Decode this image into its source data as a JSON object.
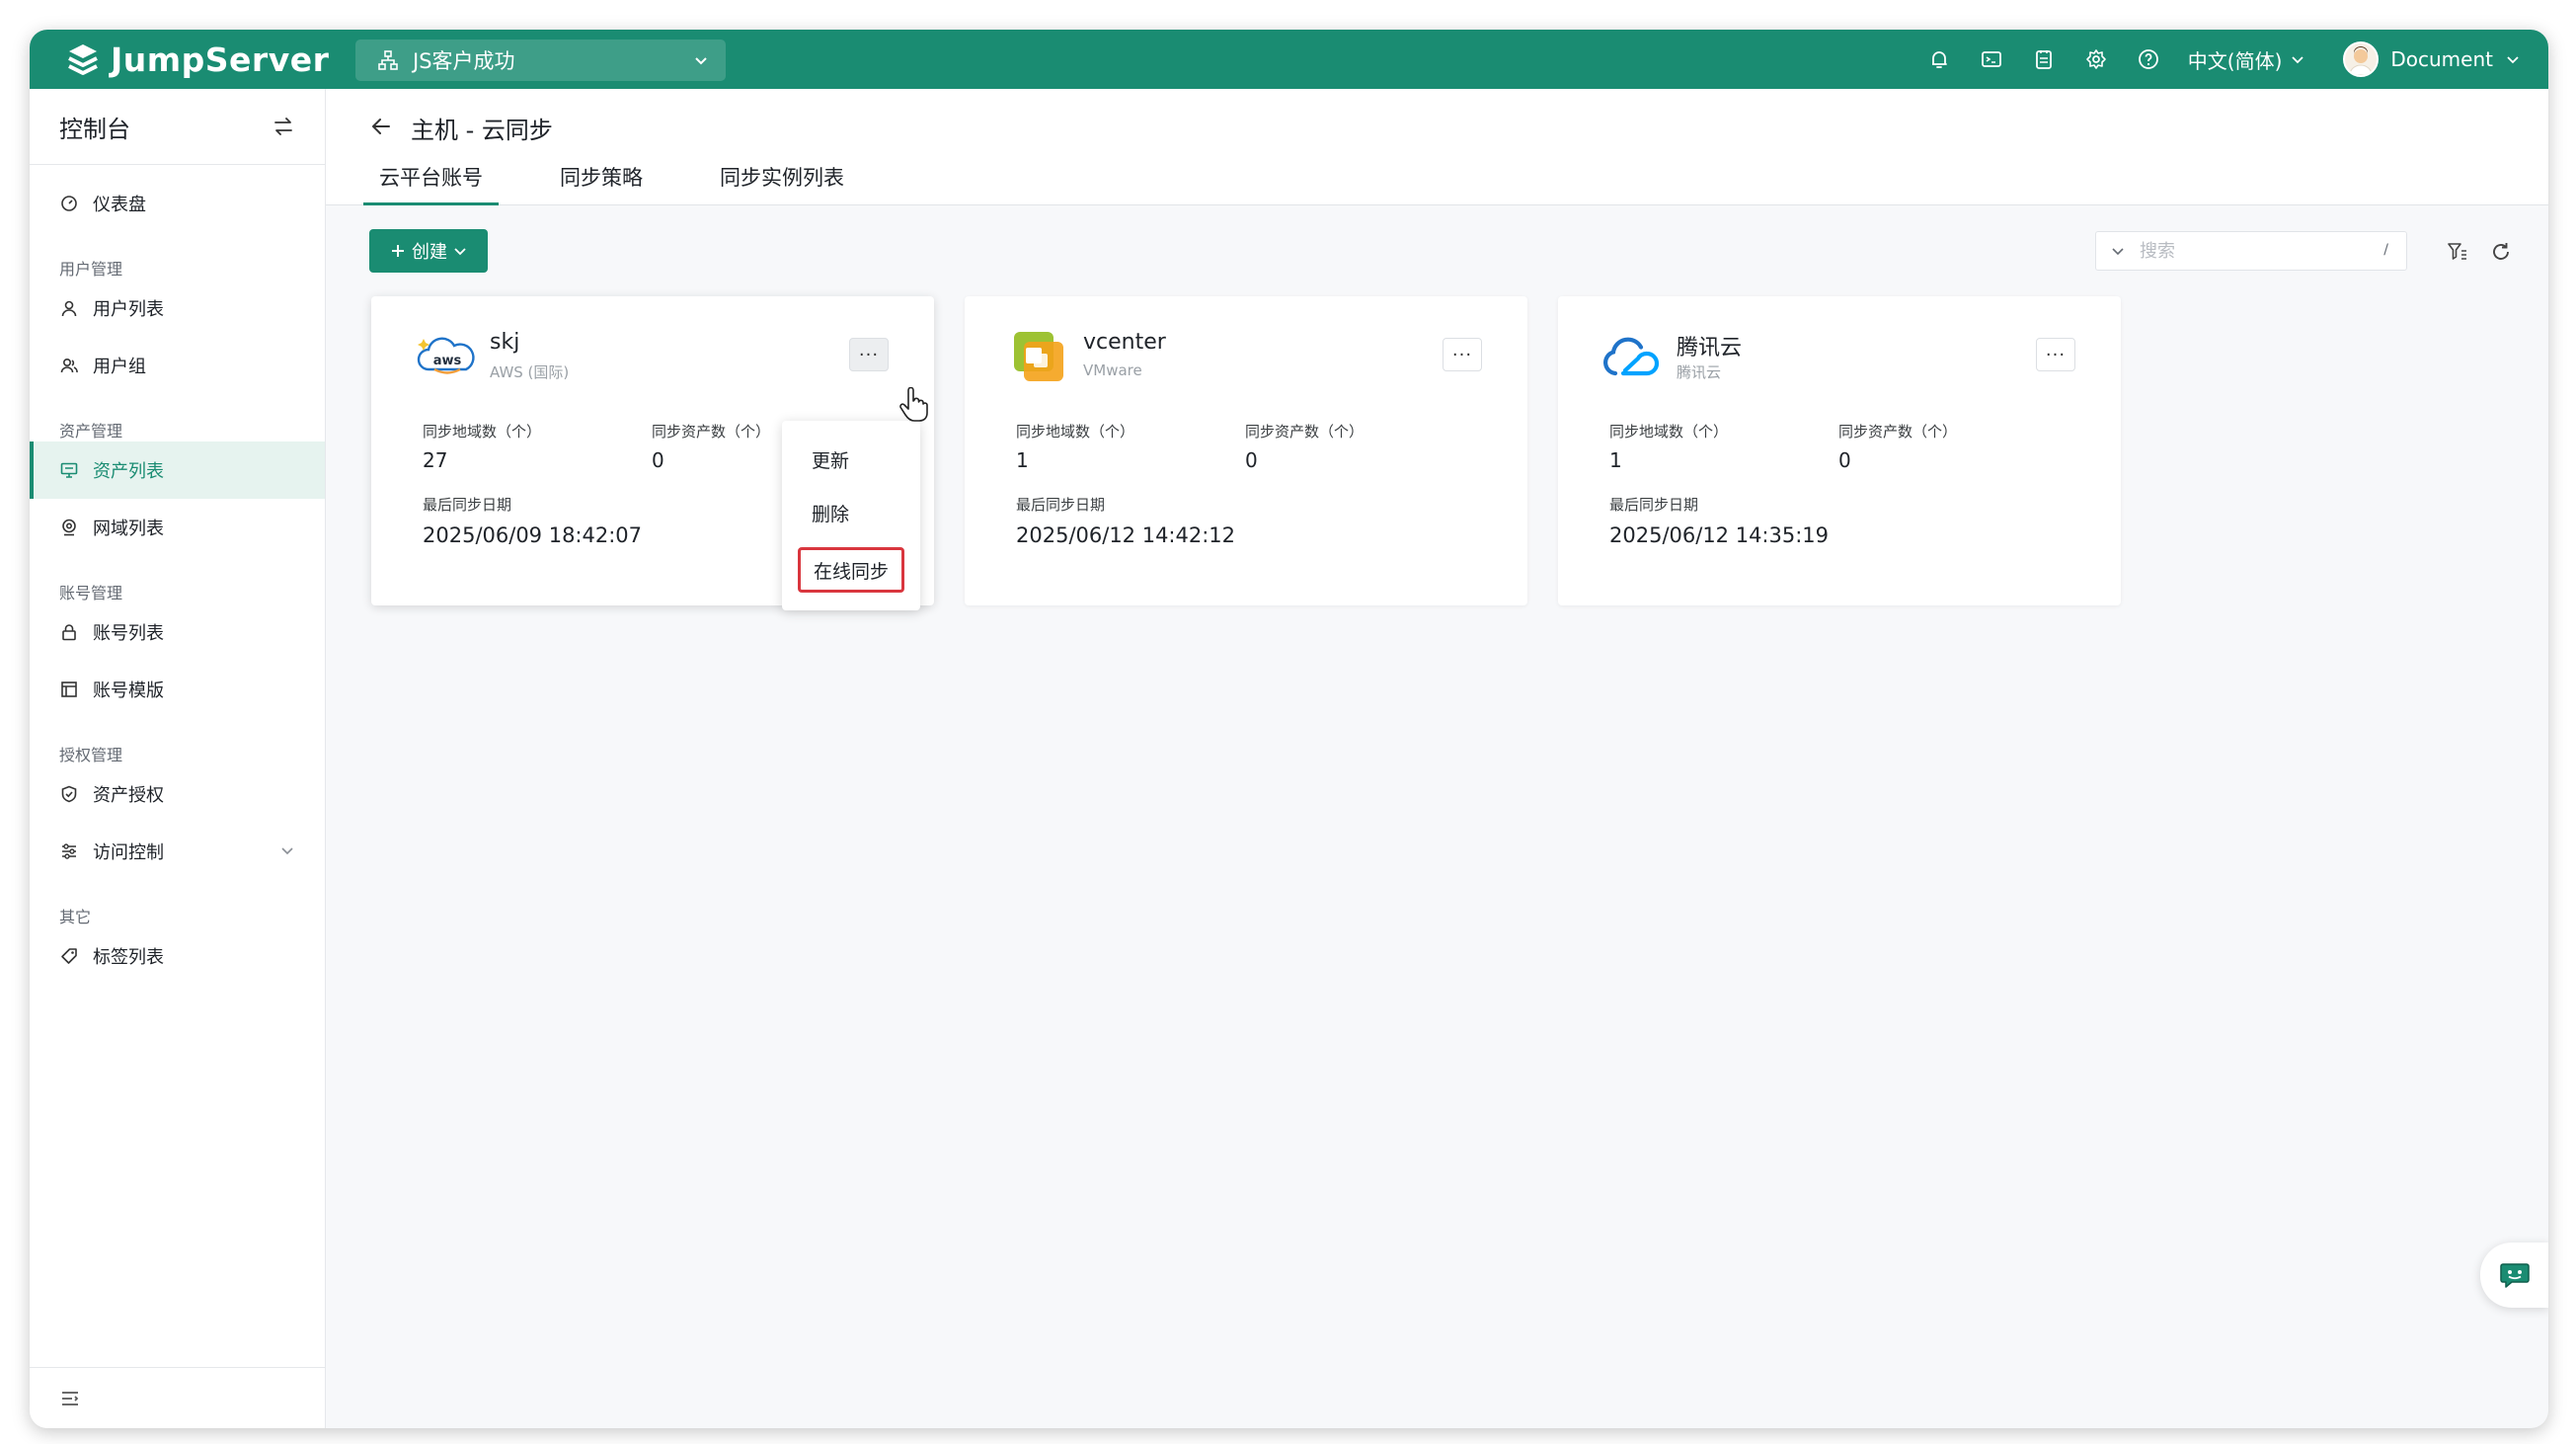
{
  "app": {
    "brand": "JumpServer"
  },
  "header": {
    "org": "JS客户成功",
    "language": "中文(简体)",
    "user": "Document"
  },
  "sidebar": {
    "title": "控制台",
    "dashboard": "仪表盘",
    "groups": {
      "users": "用户管理",
      "assets": "资产管理",
      "accounts": "账号管理",
      "perms": "授权管理",
      "other": "其它"
    },
    "items": {
      "user_list": "用户列表",
      "user_group": "用户组",
      "asset_list": "资产列表",
      "zone_list": "网域列表",
      "account_list": "账号列表",
      "account_template": "账号模版",
      "asset_perm": "资产授权",
      "access_control": "访问控制",
      "label_list": "标签列表"
    }
  },
  "page": {
    "title": "主机 - 云同步",
    "tabs": [
      "云平台账号",
      "同步策略",
      "同步实例列表"
    ],
    "create_label": "创建",
    "search_placeholder": "搜索",
    "search_shortcut": "/"
  },
  "cards": [
    {
      "name": "skj",
      "type": "AWS (国际)",
      "regions_label": "同步地域数（个）",
      "regions": "27",
      "assets_label": "同步资产数（个）",
      "assets": "0",
      "date_label": "最后同步日期",
      "date": "2025/06/09 18:42:07"
    },
    {
      "name": "vcenter",
      "type": "VMware",
      "regions_label": "同步地域数（个）",
      "regions": "1",
      "assets_label": "同步资产数（个）",
      "assets": "0",
      "date_label": "最后同步日期",
      "date": "2025/06/12 14:42:12"
    },
    {
      "name": "腾讯云",
      "type": "腾讯云",
      "regions_label": "同步地域数（个）",
      "regions": "1",
      "assets_label": "同步资产数（个）",
      "assets": "0",
      "date_label": "最后同步日期",
      "date": "2025/06/12 14:35:19"
    }
  ],
  "card_menu": {
    "update": "更新",
    "delete": "删除",
    "online_sync": "在线同步"
  },
  "colors": {
    "brand": "#1a8c72",
    "highlight": "#d9363e"
  }
}
